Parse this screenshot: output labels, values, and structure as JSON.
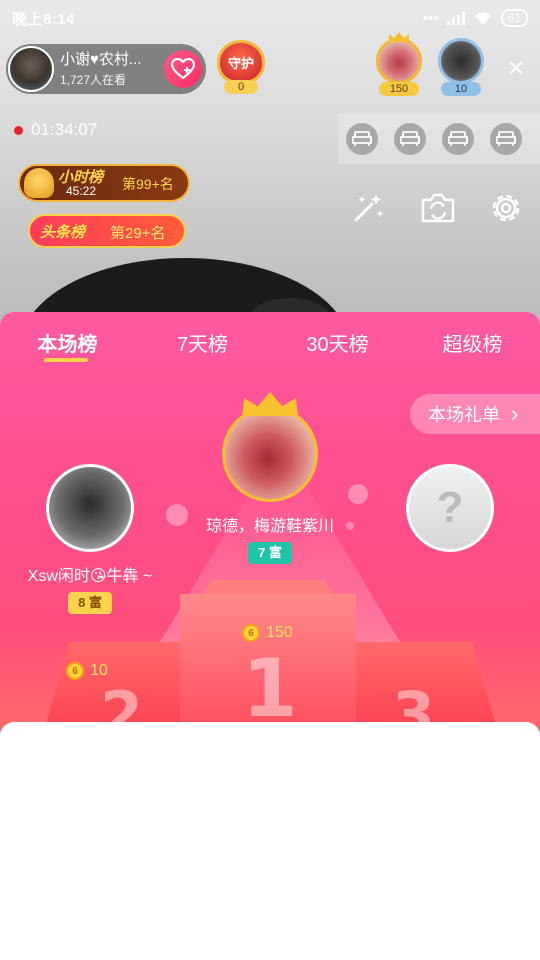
{
  "status_bar": {
    "time": "晚上8:14",
    "dots": "•••",
    "battery": "61"
  },
  "host": {
    "name": "小谢♥农村...",
    "viewers": "1,727人在看"
  },
  "guard": {
    "label": "守护",
    "count": "0"
  },
  "top_fans": [
    {
      "count": "150"
    },
    {
      "count": "10"
    }
  ],
  "close_glyph": "×",
  "live_timer": "01:34:07",
  "hour_rank": {
    "title": "小时榜",
    "timer": "45:22",
    "place": "第99+名"
  },
  "headline_rank": {
    "title": "头条榜",
    "place": "第29+名"
  },
  "leaderboard": {
    "tabs": [
      "本场榜",
      "7天榜",
      "30天榜",
      "超级榜"
    ],
    "active_tab": "本场榜",
    "gift_list_label": "本场礼单",
    "gift_list_arrow": "›",
    "first": {
      "name": "琼德，梅游鞋紫川",
      "wealth": "7 富",
      "score": "150",
      "podium": "1"
    },
    "second": {
      "name": "Xsw闲时😘牛犇 ~",
      "wealth": "8 富",
      "score": "10",
      "podium": "2"
    },
    "third": {
      "placeholder": "?",
      "podium": "3"
    },
    "coin_glyph": "6"
  },
  "icons": {
    "follow": "heart-plus-icon",
    "seat": "sofa-icon",
    "beauty": "magic-wand-icon",
    "camera": "camera-switch-icon",
    "settings": "gear-icon"
  },
  "colors": {
    "panel_top": "#ff5aa0",
    "panel_bottom": "#ff6b6b",
    "accent_gold": "#ffd24c",
    "wealth_teal": "#1fc4a9",
    "wealth_yellow": "#f9d24e"
  }
}
